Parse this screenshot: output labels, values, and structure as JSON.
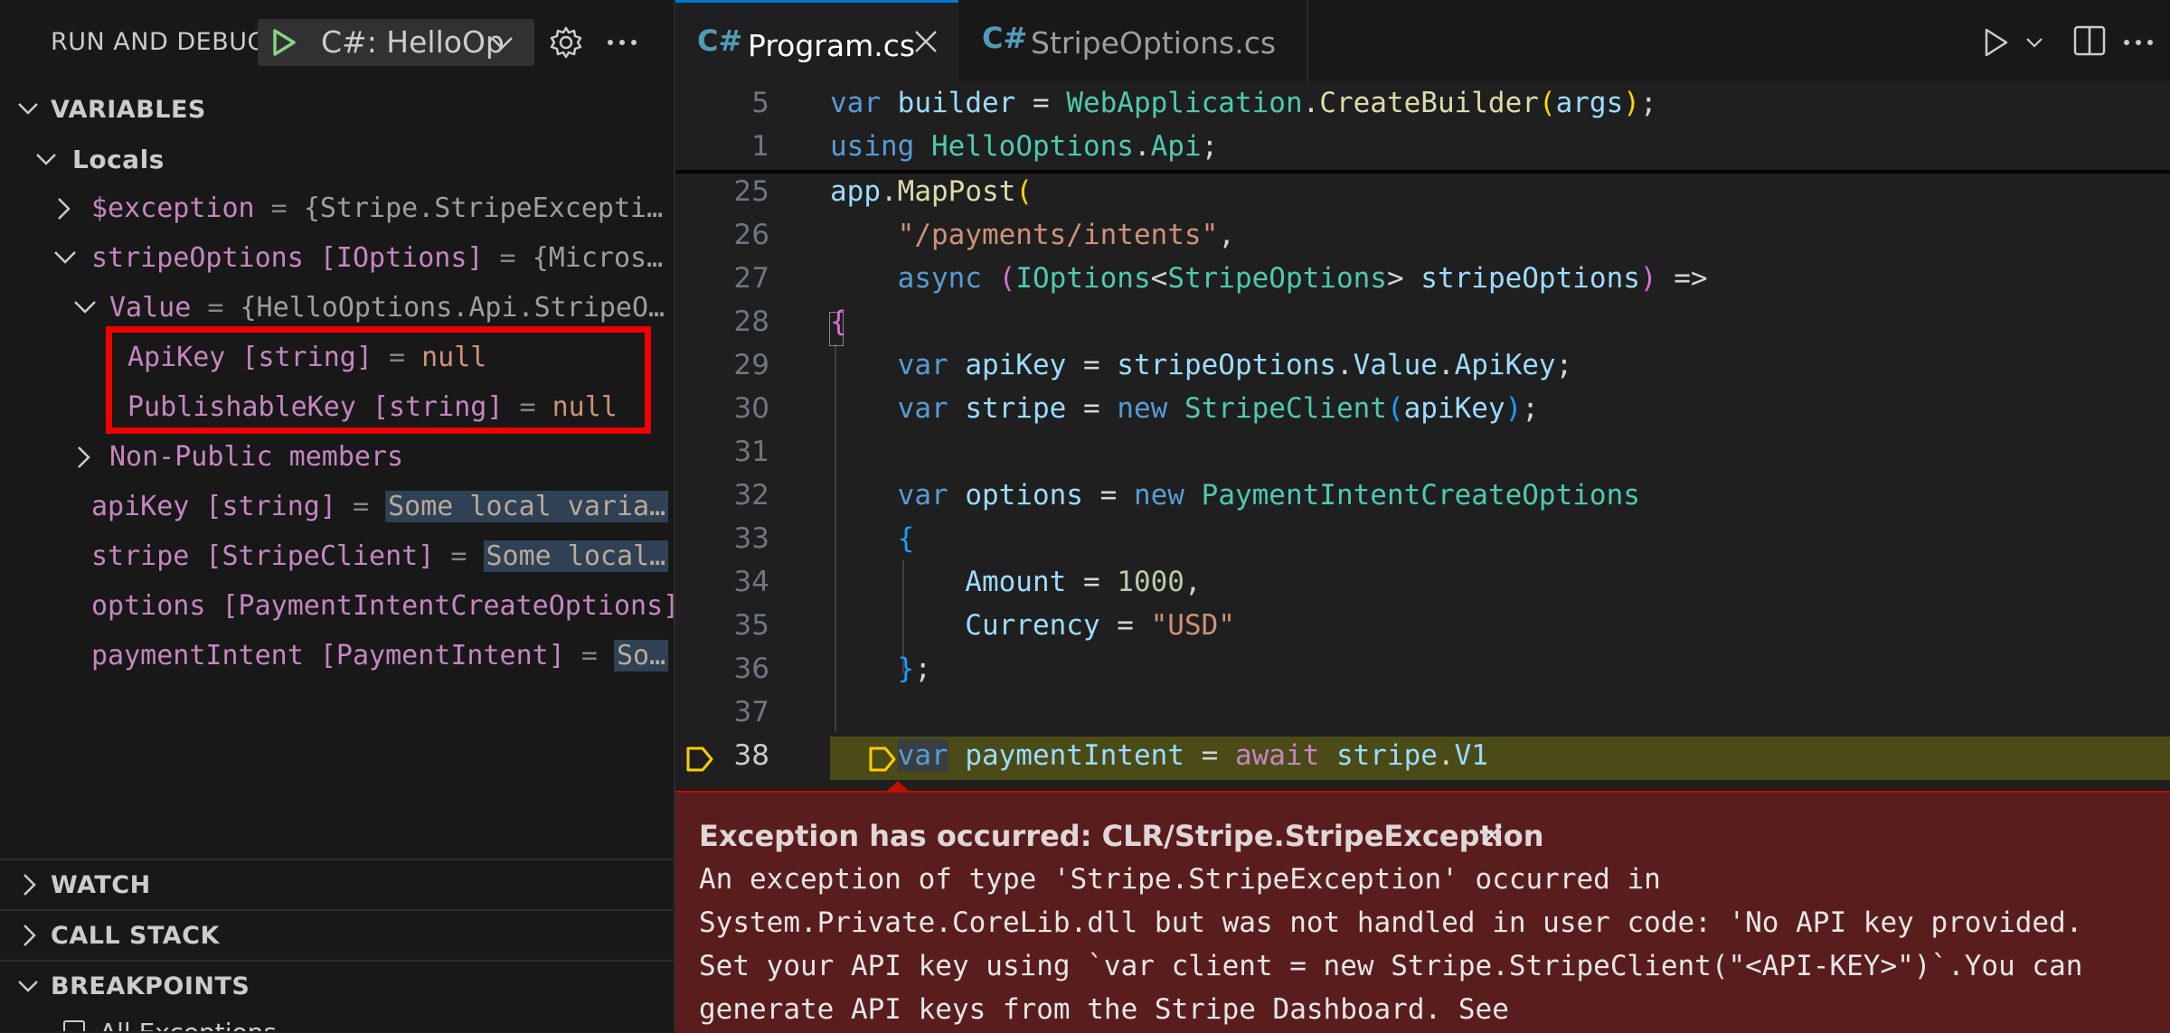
{
  "sidebar": {
    "title": "RUN AND DEBUG",
    "config": "C#: HelloOp",
    "sections": {
      "variables": "VARIABLES",
      "locals": "Locals",
      "watch": "WATCH",
      "call_stack": "CALL STACK",
      "breakpoints": "BREAKPOINTS"
    },
    "variables": {
      "exception": {
        "name": "$exception",
        "eq": " = ",
        "value": "{Stripe.StripeExcepti…"
      },
      "stripeOptions": {
        "name": "stripeOptions",
        "type": " [IOptions]",
        "eq": " = ",
        "value": "{Micros…"
      },
      "value_node": {
        "name": "Value",
        "eq": " = ",
        "value": "{HelloOptions.Api.StripeO…"
      },
      "apiKeyProp": {
        "name": "ApiKey",
        "type": " [string]",
        "eq": " = ",
        "value": "null"
      },
      "publishableKeyProp": {
        "name": "PublishableKey",
        "type": " [string]",
        "eq": " = ",
        "value": "null"
      },
      "nonPublic": "Non-Public members",
      "apiKey": {
        "name": "apiKey",
        "type": " [string]",
        "eq": " = ",
        "value": "Some local varia…"
      },
      "stripe": {
        "name": "stripe",
        "type": " [StripeClient]",
        "eq": " = ",
        "value": "Some local…"
      },
      "options": {
        "name": "options",
        "type": " [PaymentIntentCreateOptions]"
      },
      "paymentIntent": {
        "name": "paymentIntent",
        "type": " [PaymentIntent]",
        "eq": " = ",
        "value": "So…"
      }
    },
    "breakpoints_first_item": "All Exceptions"
  },
  "tabs": [
    {
      "icon": "C#",
      "label": "Program.cs",
      "active": true
    },
    {
      "icon": "C#",
      "label": "StripeOptions.cs",
      "active": false
    }
  ],
  "editor": {
    "sticky_lines": [
      "5",
      "1"
    ],
    "line_numbers": [
      "25",
      "26",
      "27",
      "28",
      "29",
      "30",
      "31",
      "32",
      "33",
      "34",
      "35",
      "36",
      "37",
      "38"
    ],
    "current_line": "38"
  },
  "exception": {
    "title": "Exception has occurred: CLR/Stripe.StripeException",
    "lines": [
      "An exception of type 'Stripe.StripeException' occurred in",
      "System.Private.CoreLib.dll but was not handled in user code: 'No API key provided.",
      "Set your API key using `var client = new Stripe.StripeClient(\"<API-KEY>\")`.You can",
      "generate API keys from the Stripe Dashboard. See"
    ]
  },
  "colors": {
    "accent": "#0078d4",
    "highlight_box": "#f00000",
    "exception_bg": "#5a1d1d",
    "current_line": "#4b4b18"
  }
}
